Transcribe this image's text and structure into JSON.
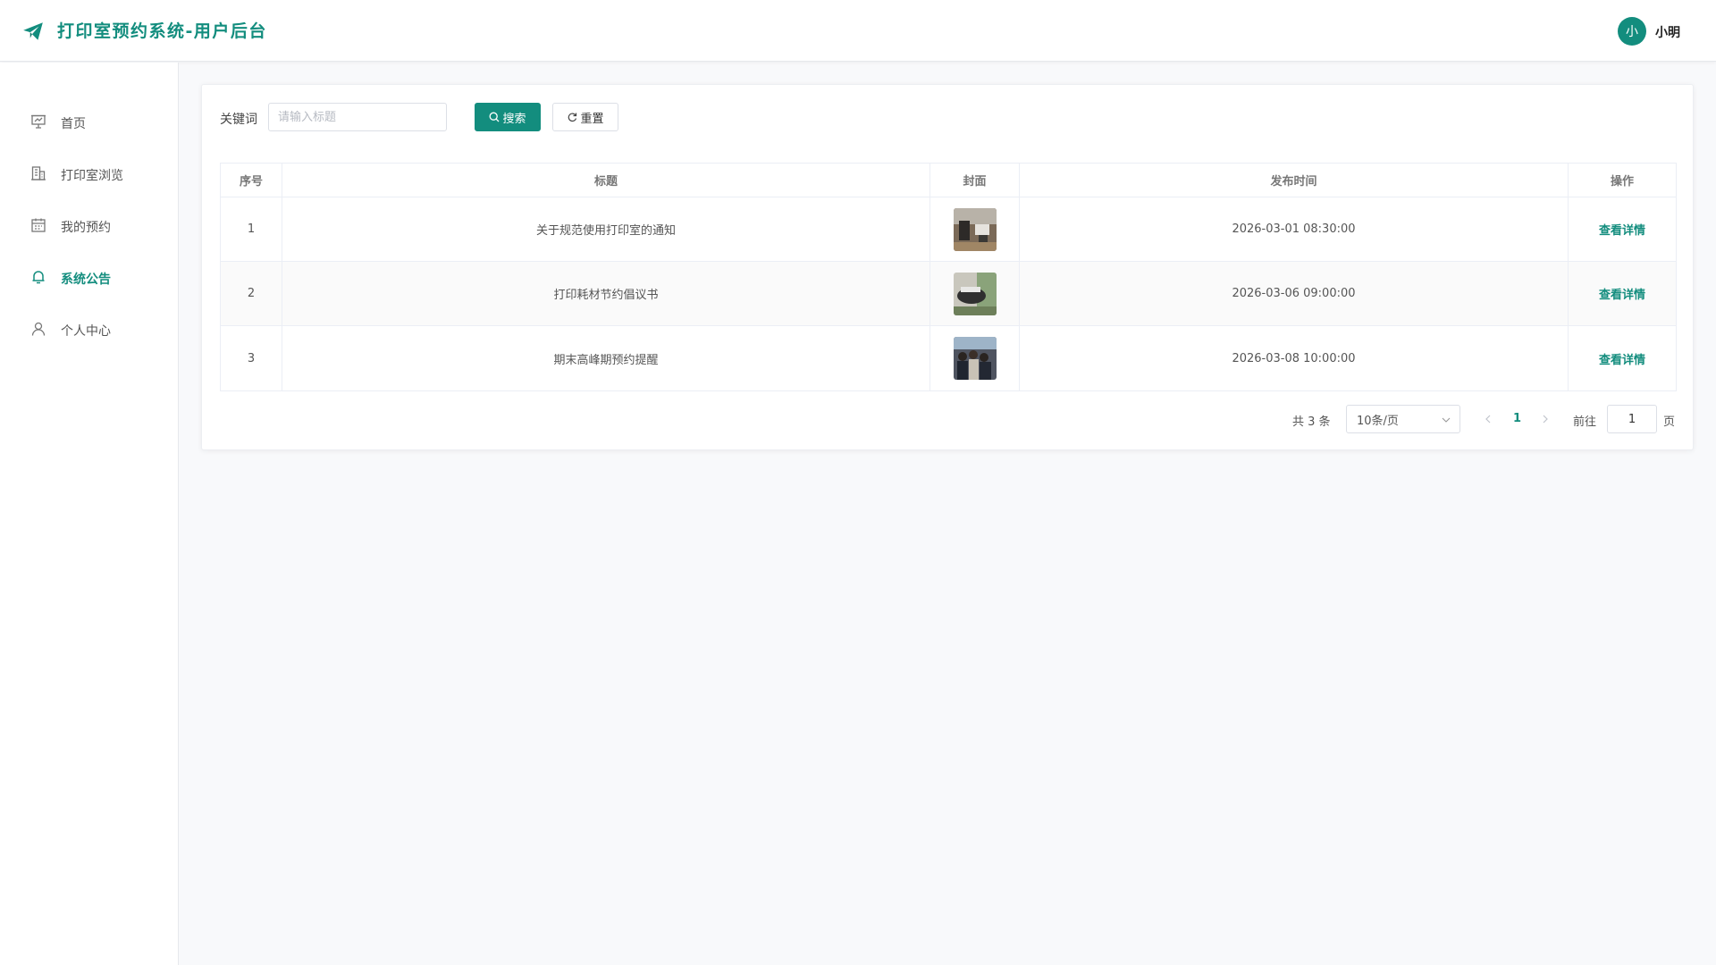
{
  "header": {
    "title": "打印室预约系统-用户后台",
    "avatar_text": "小",
    "username": "小明",
    "logo_icon": "paper-plane-icon",
    "accent_color": "#138d7e"
  },
  "sidebar": {
    "items": [
      {
        "label": "首页",
        "icon": "presentation-board-icon",
        "active": false
      },
      {
        "label": "打印室浏览",
        "icon": "building-icon",
        "active": false
      },
      {
        "label": "我的预约",
        "icon": "calendar-icon",
        "active": false
      },
      {
        "label": "系统公告",
        "icon": "bell-icon",
        "active": true
      },
      {
        "label": "个人中心",
        "icon": "user-icon",
        "active": false
      }
    ]
  },
  "search": {
    "label": "关键词",
    "placeholder": "请输入标题",
    "value": "",
    "search_button": "搜索",
    "reset_button": "重置"
  },
  "table": {
    "columns": [
      "序号",
      "标题",
      "封面",
      "发布时间",
      "操作"
    ],
    "rows": [
      {
        "index": "1",
        "title": "关于规范使用打印室的通知",
        "published": "2026-03-01 08:30:00",
        "action": "查看详情"
      },
      {
        "index": "2",
        "title": "打印耗材节约倡议书",
        "published": "2026-03-06 09:00:00",
        "action": "查看详情"
      },
      {
        "index": "3",
        "title": "期末高峰期预约提醒",
        "published": "2026-03-08 10:00:00",
        "action": "查看详情"
      }
    ]
  },
  "pagination": {
    "total": "共 3 条",
    "page_size": "10条/页",
    "current_page": "1",
    "goto_label": "前往",
    "goto_value": "1",
    "page_suffix": "页"
  }
}
